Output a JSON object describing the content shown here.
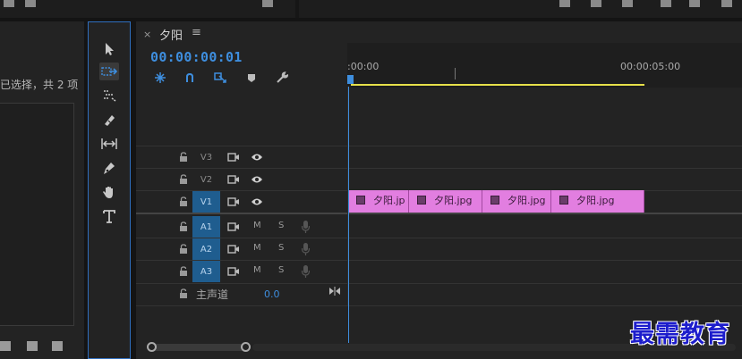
{
  "project_panel": {
    "selection_text": "已选择，共 2 项"
  },
  "sequence": {
    "tab_close": "×",
    "tab_title": "夕阳",
    "tab_menu": "≡",
    "timecode": "00:00:00:01",
    "ruler_labels": [
      ":00:00",
      "00:00:05:00"
    ]
  },
  "tracks": {
    "video": [
      {
        "label": "V3",
        "targeted": false
      },
      {
        "label": "V2",
        "targeted": false
      },
      {
        "label": "V1",
        "targeted": true
      }
    ],
    "audio": [
      {
        "label": "A1",
        "targeted": true,
        "mute": "M",
        "solo": "S"
      },
      {
        "label": "A2",
        "targeted": true,
        "mute": "M",
        "solo": "S"
      },
      {
        "label": "A3",
        "targeted": true,
        "mute": "M",
        "solo": "S"
      }
    ],
    "master": {
      "label": "主声道",
      "value": "0.0"
    }
  },
  "clips": [
    {
      "name": "夕阳.jp"
    },
    {
      "name": "夕阳.jpg"
    },
    {
      "name": "夕阳.jpg"
    },
    {
      "name": "夕阳.jpg"
    }
  ],
  "watermark": "最需教育",
  "colors": {
    "accent": "#3e8ede",
    "clip": "#e27ee0",
    "workarea": "#e6e04a",
    "track_target": "#1f5d8f"
  }
}
